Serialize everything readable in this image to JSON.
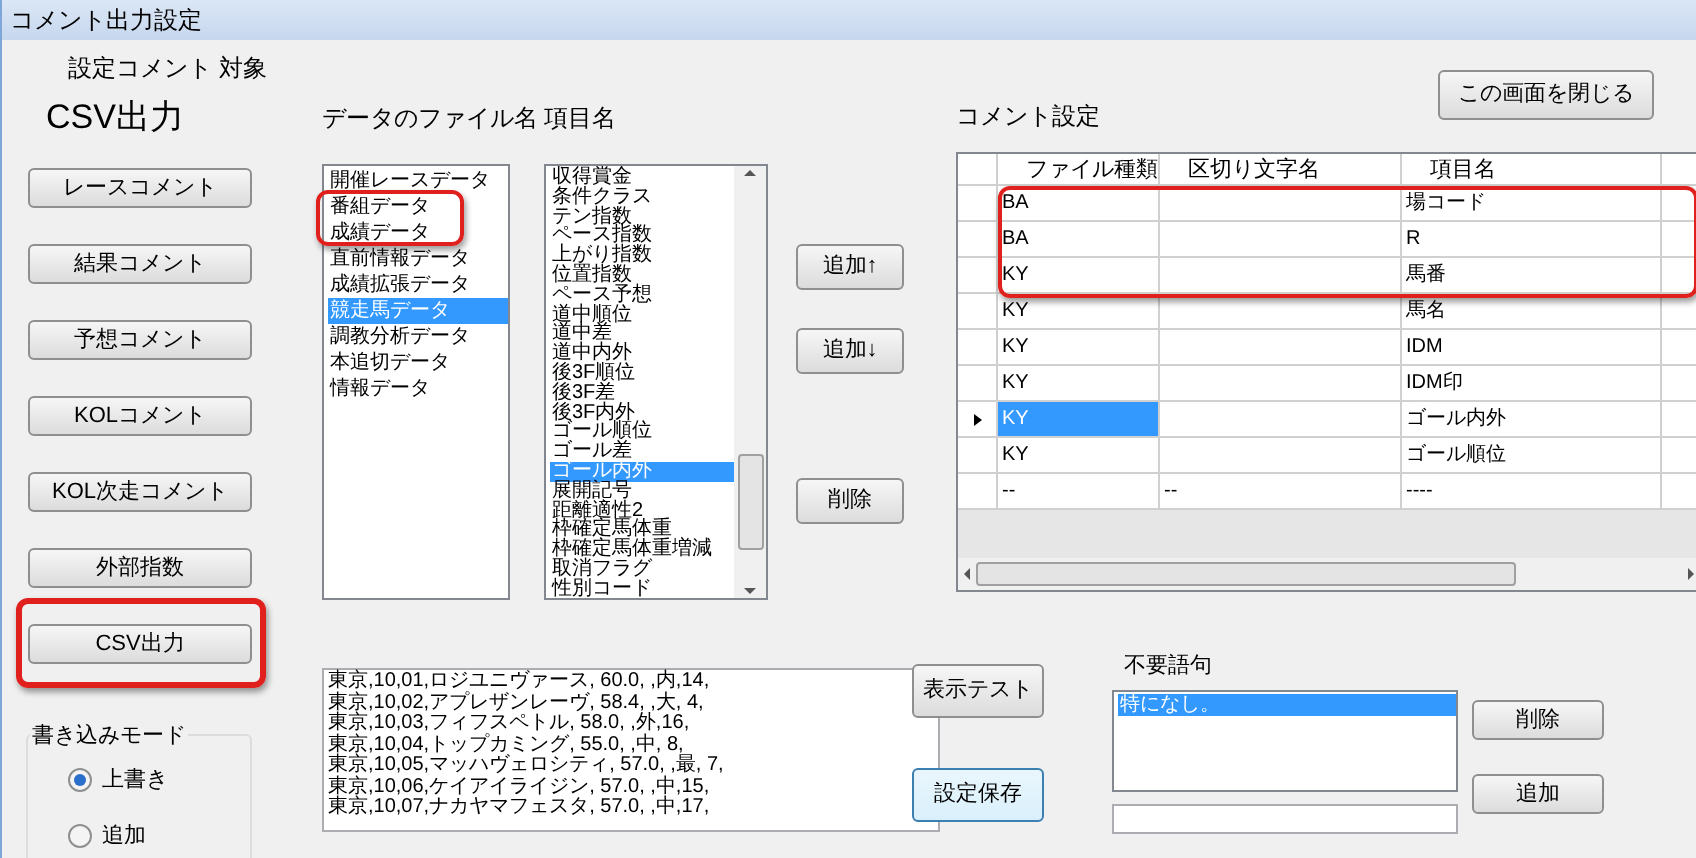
{
  "window": {
    "title": "コメント出力設定"
  },
  "target": {
    "label": "設定コメント 対象",
    "current": "CSV出力"
  },
  "comment_buttons": [
    {
      "label": "レースコメント",
      "highlighted": false
    },
    {
      "label": "結果コメント",
      "highlighted": false
    },
    {
      "label": "予想コメント",
      "highlighted": false
    },
    {
      "label": "KOLコメント",
      "highlighted": false
    },
    {
      "label": "KOL次走コメント",
      "highlighted": false
    },
    {
      "label": "外部指数",
      "highlighted": false
    },
    {
      "label": "CSV出力",
      "highlighted": true
    }
  ],
  "write_mode": {
    "label": "書き込みモード",
    "options": [
      {
        "label": "上書き",
        "selected": true
      },
      {
        "label": "追加",
        "selected": false
      }
    ]
  },
  "file_list": {
    "label": "データのファイル名",
    "items": [
      {
        "label": "開催レースデータ",
        "selected": false
      },
      {
        "label": "番組データ",
        "selected": false,
        "highlighted": true
      },
      {
        "label": "成績データ",
        "selected": false,
        "highlighted": true
      },
      {
        "label": "直前情報データ",
        "selected": false
      },
      {
        "label": "成績拡張データ",
        "selected": false
      },
      {
        "label": "競走馬データ",
        "selected": true
      },
      {
        "label": "調教分析データ",
        "selected": false
      },
      {
        "label": "本追切データ",
        "selected": false
      },
      {
        "label": "情報データ",
        "selected": false
      }
    ]
  },
  "item_list": {
    "label": "項目名",
    "items": [
      {
        "label": "収得賞金",
        "selected": false
      },
      {
        "label": "条件クラス",
        "selected": false
      },
      {
        "label": "テン指数",
        "selected": false
      },
      {
        "label": "ペース指数",
        "selected": false
      },
      {
        "label": "上がり指数",
        "selected": false
      },
      {
        "label": "位置指数",
        "selected": false
      },
      {
        "label": "ペース予想",
        "selected": false
      },
      {
        "label": "道中順位",
        "selected": false
      },
      {
        "label": "道中差",
        "selected": false
      },
      {
        "label": "道中内外",
        "selected": false
      },
      {
        "label": "後3F順位",
        "selected": false
      },
      {
        "label": "後3F差",
        "selected": false
      },
      {
        "label": "後3F内外",
        "selected": false
      },
      {
        "label": "ゴール順位",
        "selected": false
      },
      {
        "label": "ゴール差",
        "selected": false
      },
      {
        "label": "ゴール内外",
        "selected": true
      },
      {
        "label": "展開記号",
        "selected": false
      },
      {
        "label": "距離適性2",
        "selected": false
      },
      {
        "label": "枠確定馬体重",
        "selected": false
      },
      {
        "label": "枠確定馬体重増減",
        "selected": false
      },
      {
        "label": "取消フラグ",
        "selected": false
      },
      {
        "label": "性別コード",
        "selected": false
      }
    ]
  },
  "move_buttons": [
    "追加↑",
    "追加↓",
    "削除"
  ],
  "comment_settings": {
    "label": "コメント設定",
    "close_button": "この画面を閉じる",
    "columns": [
      "ファイル種類",
      "区切り文字名",
      "項目名"
    ],
    "rows": [
      {
        "cells": [
          "BA",
          "",
          "場コード"
        ],
        "current": false,
        "highlighted": true
      },
      {
        "cells": [
          "BA",
          "",
          "R"
        ],
        "current": false,
        "highlighted": true
      },
      {
        "cells": [
          "KY",
          "",
          "馬番"
        ],
        "current": false,
        "highlighted": true
      },
      {
        "cells": [
          "KY",
          "",
          "馬名"
        ],
        "current": false,
        "highlighted": false
      },
      {
        "cells": [
          "KY",
          "",
          "IDM"
        ],
        "current": false,
        "highlighted": false
      },
      {
        "cells": [
          "KY",
          "",
          "IDM印"
        ],
        "current": false,
        "highlighted": false
      },
      {
        "cells": [
          "KY",
          "",
          "ゴール内外"
        ],
        "current": true,
        "highlighted": false
      },
      {
        "cells": [
          "KY",
          "",
          "ゴール順位"
        ],
        "current": false,
        "highlighted": false
      },
      {
        "cells": [
          "--",
          "--",
          "----"
        ],
        "current": false,
        "highlighted": false
      }
    ]
  },
  "preview": {
    "lines": [
      "東京,10,01,ロジユニヴァース, 60.0, ,内,14,",
      "東京,10,02,アプレザンレーヴ, 58.4, ,大, 4,",
      "東京,10,03,フィフスペトル, 58.0, ,外,16,",
      "東京,10,04,トップカミング, 55.0, ,中, 8,",
      "東京,10,05,マッハヴェロシティ, 57.0, ,最, 7,",
      "東京,10,06,ケイアイライジン, 57.0, ,中,15,",
      "東京,10,07,ナカヤマフェスタ, 57.0, ,中,17,"
    ]
  },
  "test_button": "表示テスト",
  "save_button": "設定保存",
  "unwanted_words": {
    "label": "不要語句",
    "items": [
      {
        "label": "特になし。",
        "selected": true
      }
    ],
    "delete_button": "削除",
    "add_button": "追加"
  }
}
